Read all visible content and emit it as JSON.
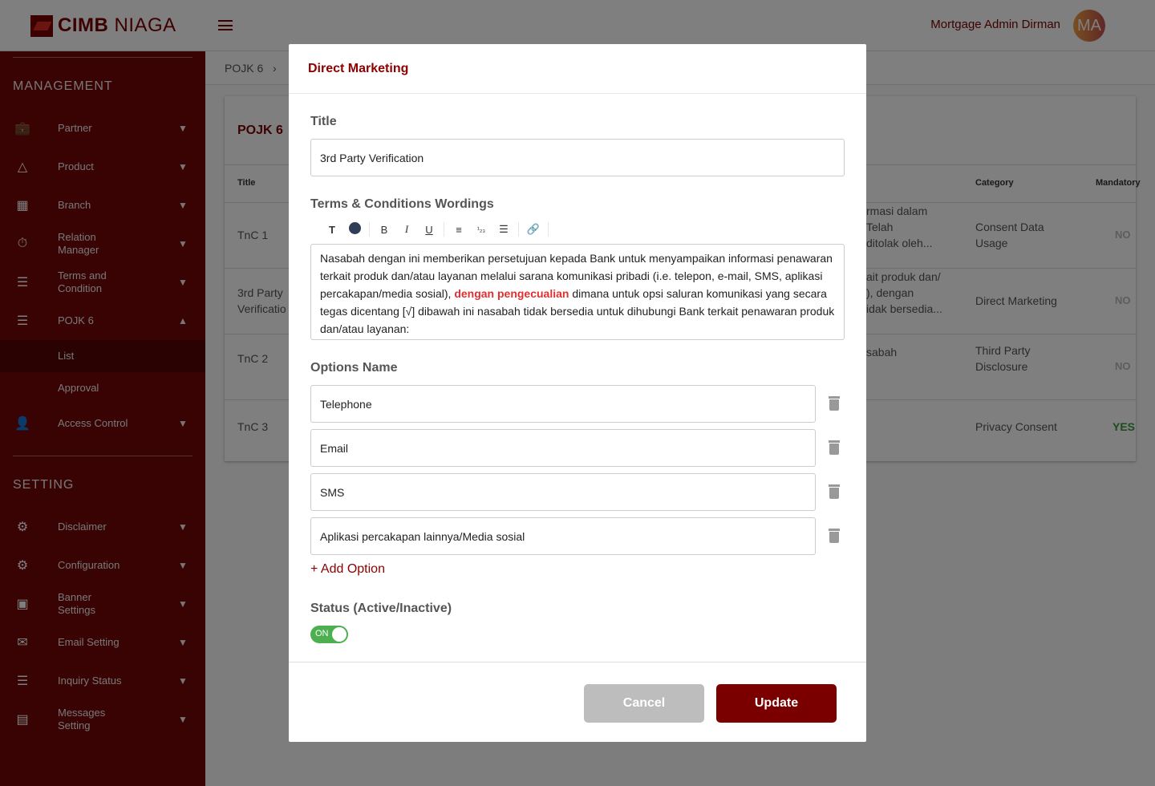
{
  "header": {
    "logo_text_bold": "CIMB",
    "logo_text": "NIAGA",
    "user_name": "Mortgage Admin Dirman",
    "avatar_initials": "MA"
  },
  "sidebar": {
    "management_heading": "MANAGEMENT",
    "setting_heading": "SETTING",
    "management_items": [
      {
        "label": "Partner",
        "icon": "briefcase-icon"
      },
      {
        "label": "Product",
        "icon": "shapes-icon"
      },
      {
        "label": "Branch",
        "icon": "building-icon"
      },
      {
        "label": "Relation Manager",
        "icon": "timer-icon"
      },
      {
        "label": "Terms and Condition",
        "icon": "list-icon"
      },
      {
        "label": "POJK 6",
        "icon": "list-icon"
      }
    ],
    "pojk_sub": [
      {
        "label": "List"
      },
      {
        "label": "Approval"
      }
    ],
    "access_control": "Access Control",
    "setting_items": [
      {
        "label": "Disclaimer",
        "icon": "gear-icon"
      },
      {
        "label": "Configuration",
        "icon": "gear-icon"
      },
      {
        "label": "Banner Settings",
        "icon": "image-icon"
      },
      {
        "label": "Email Setting",
        "icon": "mail-icon"
      },
      {
        "label": "Inquiry Status",
        "icon": "list-icon"
      },
      {
        "label": "Messages Setting",
        "icon": "message-icon"
      }
    ]
  },
  "breadcrumb": {
    "item": "POJK 6"
  },
  "card": {
    "title": "POJK 6",
    "columns": {
      "title": "Title",
      "category": "Category",
      "mandatory": "Mandatory"
    },
    "rows": [
      {
        "title": "TnC 1",
        "desc": "rmasi dalam\nTelah\nditolak oleh...",
        "category": "Consent Data\nUsage",
        "mandatory": "NO"
      },
      {
        "title": "3rd Party\nVerificatio",
        "desc": "ait produk dan/\n), dengan\nidak bersedia...",
        "category": "Direct Marketing",
        "mandatory": "NO"
      },
      {
        "title": "TnC 2",
        "desc": "sabah",
        "category": "Third Party\nDisclosure",
        "mandatory": "NO"
      },
      {
        "title": "TnC 3",
        "desc": "",
        "category": "Privacy Consent",
        "mandatory": "YES"
      }
    ]
  },
  "modal": {
    "title": "Direct Marketing",
    "title_label": "Title",
    "title_value": "3rd Party Verification",
    "terms_label": "Terms & Conditions Wordings",
    "terms_before": "Nasabah dengan ini memberikan persetujuan kepada Bank untuk menyampaikan informasi penawaran terkait produk dan/atau layanan melalui sarana komunikasi pribadi (i.e. telepon, e-mail, SMS, aplikasi percakapan/media sosial), ",
    "terms_highlight": "dengan pengecualian",
    "terms_after": " dimana untuk opsi saluran komunikasi yang secara tegas dicentang [√] dibawah ini nasabah tidak bersedia untuk dihubungi Bank terkait penawaran produk dan/atau layanan:",
    "options_label": "Options Name",
    "options": [
      "Telephone",
      "Email",
      "SMS",
      "Aplikasi percakapan lainnya/Media sosial"
    ],
    "add_option": "+ Add Option",
    "status_label": "Status (Active/Inactive)",
    "toggle_label": "ON",
    "toggle_on": true,
    "cancel": "Cancel",
    "update": "Update"
  },
  "colors": {
    "brand": "#7a0000",
    "sidebar": "#740606",
    "toggle": "#4caf50",
    "highlight": "#e03030"
  }
}
